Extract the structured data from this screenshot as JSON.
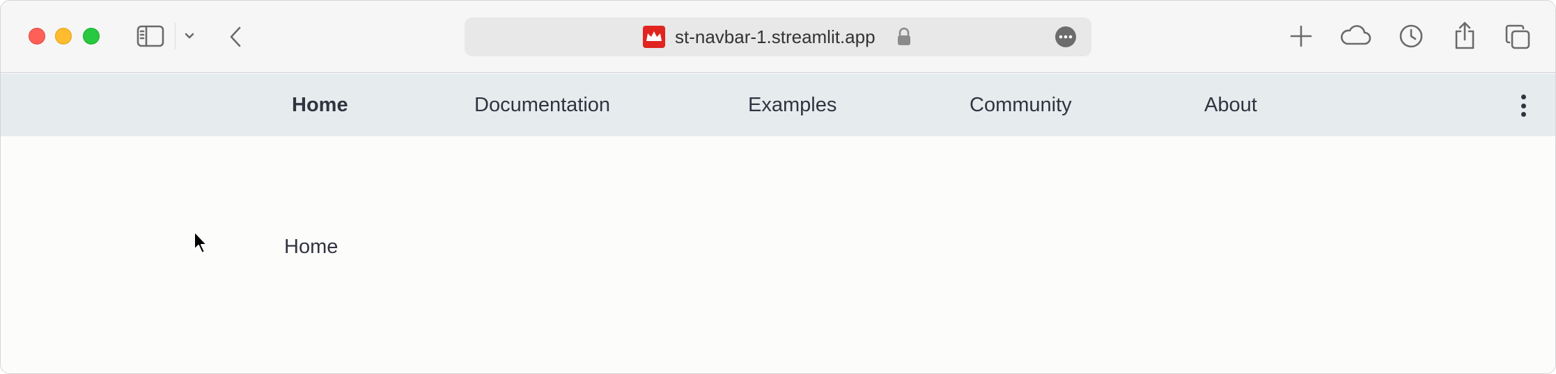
{
  "browser": {
    "url": "st-navbar-1.streamlit.app",
    "icons": [
      "sidebar-icon",
      "chevron-down-icon",
      "back-icon",
      "lock-icon",
      "more-icon",
      "plus-icon",
      "cloud-icon",
      "history-icon",
      "share-icon",
      "tabs-icon"
    ]
  },
  "navbar": {
    "items": [
      {
        "label": "Home",
        "active": true
      },
      {
        "label": "Documentation"
      },
      {
        "label": "Examples"
      },
      {
        "label": "Community"
      },
      {
        "label": "About"
      }
    ]
  },
  "main": {
    "text": "Home"
  },
  "colors": {
    "navbar_bg": "#e6ebee",
    "text": "#31333f",
    "favicon": "#e0241f"
  }
}
